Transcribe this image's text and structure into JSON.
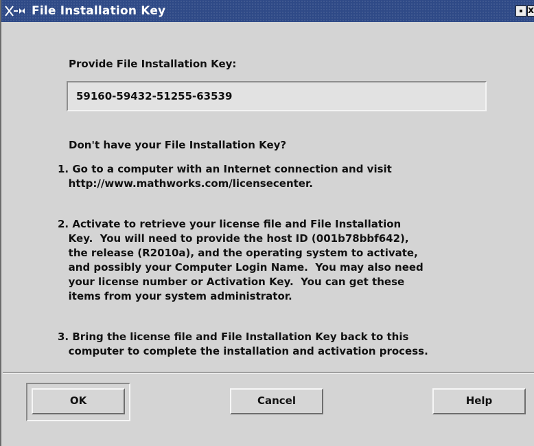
{
  "window": {
    "title": "File Installation Key",
    "icon": "x-window-menu-icon"
  },
  "main": {
    "key_heading": "Provide File Installation Key:",
    "key_value": "59160-59432-51255-63539",
    "help_heading": "Don't have your File Installation Key?",
    "steps": [
      "1. Go to a computer with an Internet connection and visit\n   http://www.mathworks.com/licensecenter.",
      "2. Activate to retrieve your license file and File Installation\n   Key.  You will need to provide the host ID (001b78bbf642),\n   the release (R2010a), and the operating system to activate,\n   and possibly your Computer Login Name.  You may also need\n   your license number or Activation Key.  You can get these\n   items from your system administrator.",
      "3. Bring the license file and File Installation Key back to this\n   computer to complete the installation and activation process."
    ]
  },
  "buttons": {
    "ok": "OK",
    "cancel": "Cancel",
    "help": "Help"
  },
  "colors": {
    "titlebar": "#2f4a87",
    "background": "#d4d4d4"
  }
}
